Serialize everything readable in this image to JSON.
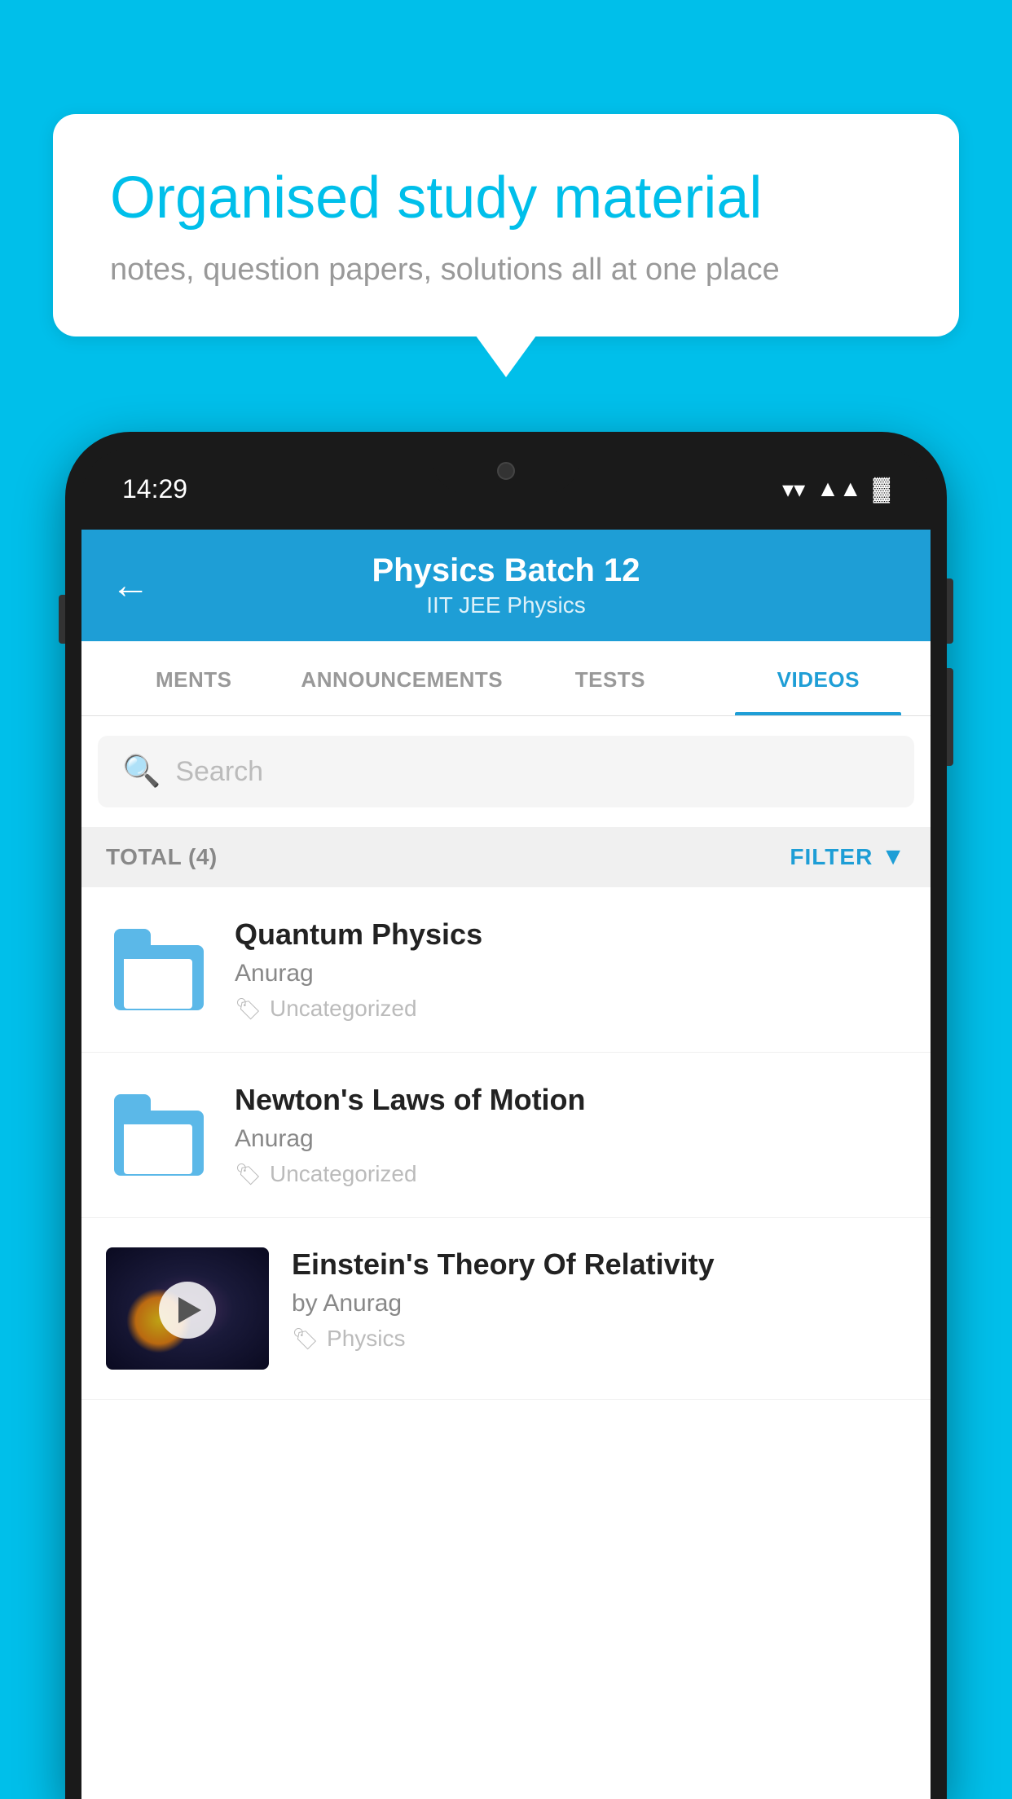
{
  "background_color": "#00BFEA",
  "speech_bubble": {
    "heading": "Organised study material",
    "subtext": "notes, question papers, solutions all at one place"
  },
  "phone": {
    "time": "14:29",
    "header": {
      "batch_name": "Physics Batch 12",
      "batch_meta": "IIT JEE   Physics",
      "back_label": "←"
    },
    "tabs": [
      {
        "label": "MENTS",
        "active": false
      },
      {
        "label": "ANNOUNCEMENTS",
        "active": false
      },
      {
        "label": "TESTS",
        "active": false
      },
      {
        "label": "VIDEOS",
        "active": true
      }
    ],
    "search": {
      "placeholder": "Search"
    },
    "total_bar": {
      "count_label": "TOTAL (4)",
      "filter_label": "FILTER"
    },
    "videos": [
      {
        "title": "Quantum Physics",
        "author": "Anurag",
        "tag": "Uncategorized",
        "type": "folder",
        "thumbnail": null
      },
      {
        "title": "Newton's Laws of Motion",
        "author": "Anurag",
        "tag": "Uncategorized",
        "type": "folder",
        "thumbnail": null
      },
      {
        "title": "Einstein's Theory Of Relativity",
        "author": "by Anurag",
        "tag": "Physics",
        "type": "video",
        "thumbnail": "space"
      }
    ]
  }
}
